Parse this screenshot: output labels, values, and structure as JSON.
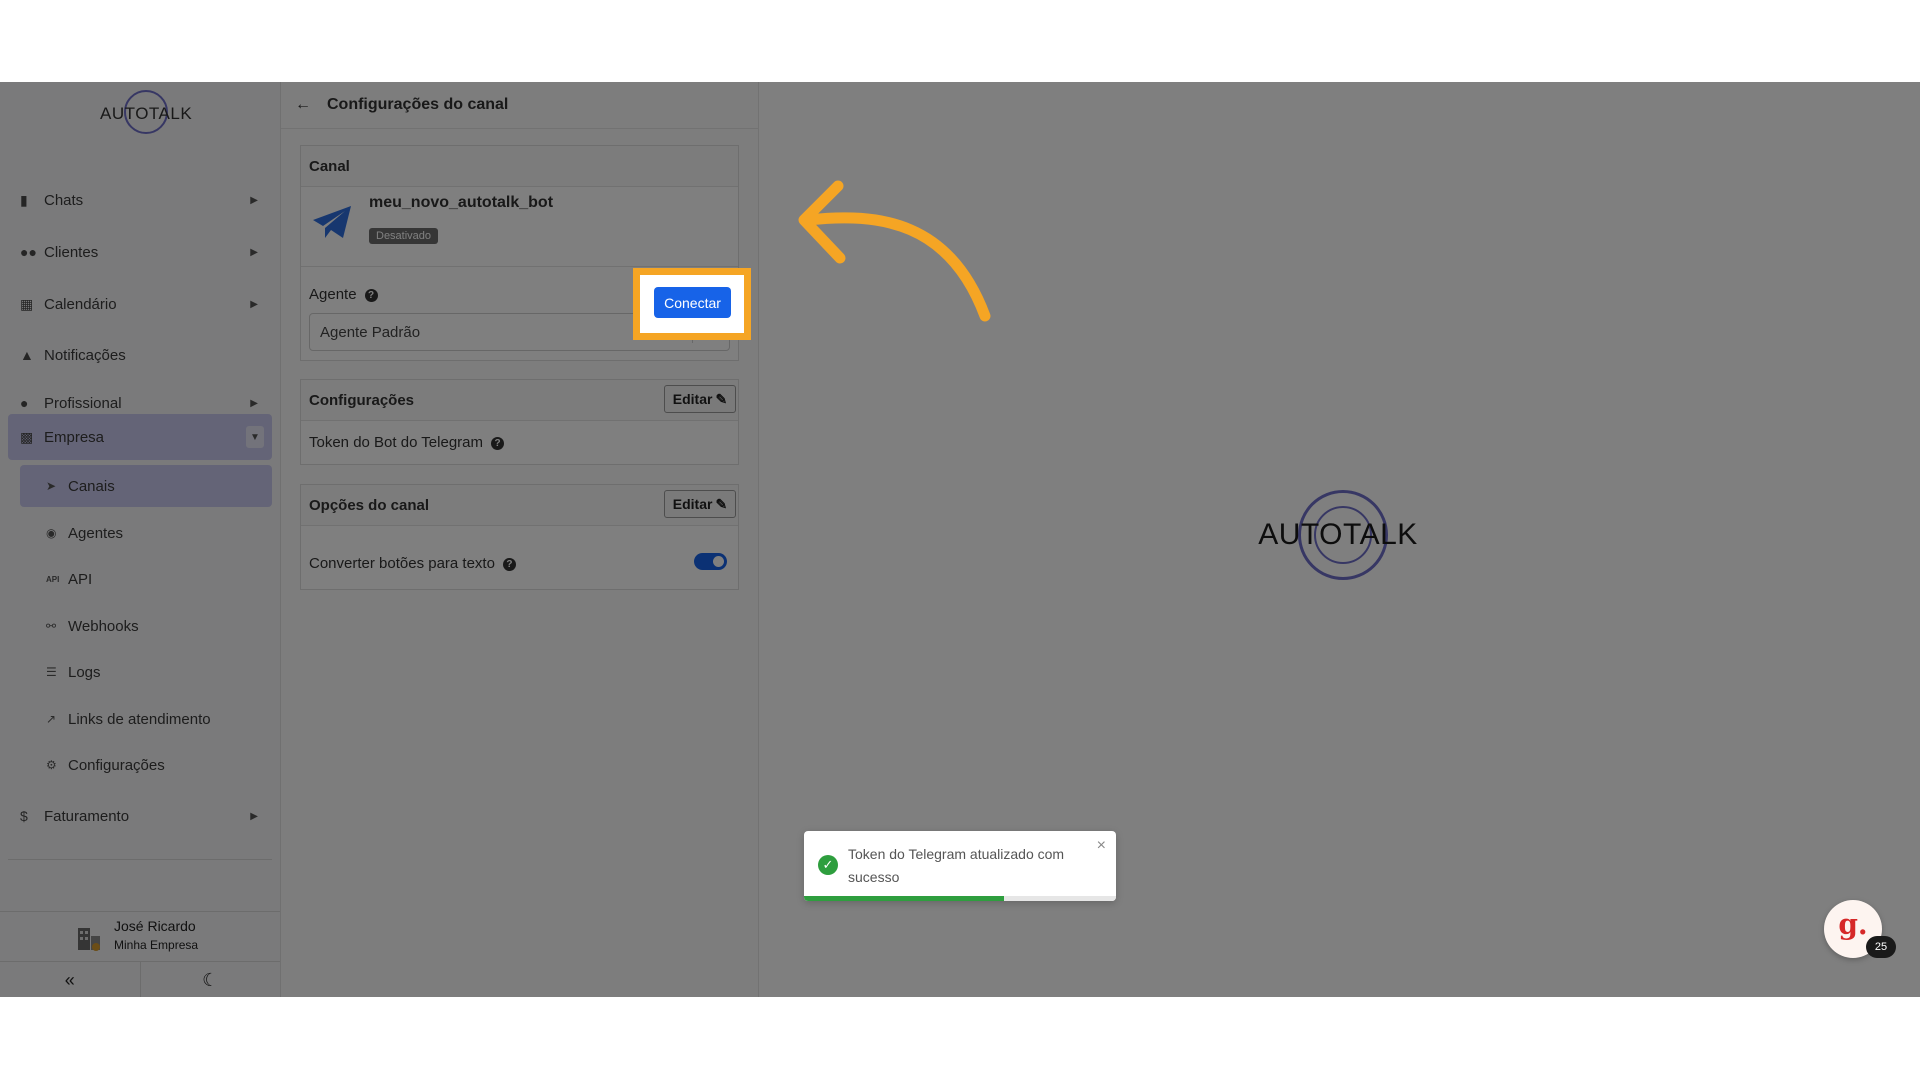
{
  "sidebar": {
    "logo_text": "AUTOTALK",
    "items": [
      {
        "label": "Chats",
        "icon": "comment-icon"
      },
      {
        "label": "Clientes",
        "icon": "users-icon"
      },
      {
        "label": "Calendário",
        "icon": "calendar-icon"
      },
      {
        "label": "Notificações",
        "icon": "bell-icon"
      },
      {
        "label": "Profissional",
        "icon": "user-gear-icon"
      },
      {
        "label": "Empresa",
        "icon": "building-icon"
      },
      {
        "label": "Faturamento",
        "icon": "dollar-icon"
      }
    ],
    "subitems": [
      {
        "label": "Canais",
        "icon": "rocket-icon"
      },
      {
        "label": "Agentes",
        "icon": "robot-icon"
      },
      {
        "label": "API",
        "icon": "api-icon"
      },
      {
        "label": "Webhooks",
        "icon": "webhook-icon"
      },
      {
        "label": "Logs",
        "icon": "list-icon"
      },
      {
        "label": "Links de atendimento",
        "icon": "external-link-icon"
      },
      {
        "label": "Configurações",
        "icon": "gear-icon"
      }
    ],
    "user": {
      "name": "José Ricardo",
      "company": "Minha Empresa"
    }
  },
  "panel": {
    "title": "Configurações do canal",
    "canal": {
      "header": "Canal",
      "bot_name": "meu_novo_autotalk_bot",
      "status": "Desativado",
      "connect_label": "Conectar",
      "agent_label": "Agente",
      "agent_value": "Agente Padrão"
    },
    "config": {
      "header": "Configurações",
      "edit_label": "Editar",
      "token_label": "Token do Bot do Telegram"
    },
    "options": {
      "header": "Opções do canal",
      "edit_label": "Editar",
      "convert_label": "Converter botões para texto",
      "convert_enabled": true
    }
  },
  "main": {
    "logo_text": "AUTOTALK"
  },
  "toast": {
    "message": "Token do Telegram atualizado com sucesso",
    "progress": 0.64
  },
  "help_widget": {
    "letter": "g.",
    "count": "25"
  },
  "colors": {
    "accent": "#1763e8",
    "highlight": "#f5a524",
    "success": "#2e9e3e",
    "active_nav": "#c8c8ee"
  }
}
